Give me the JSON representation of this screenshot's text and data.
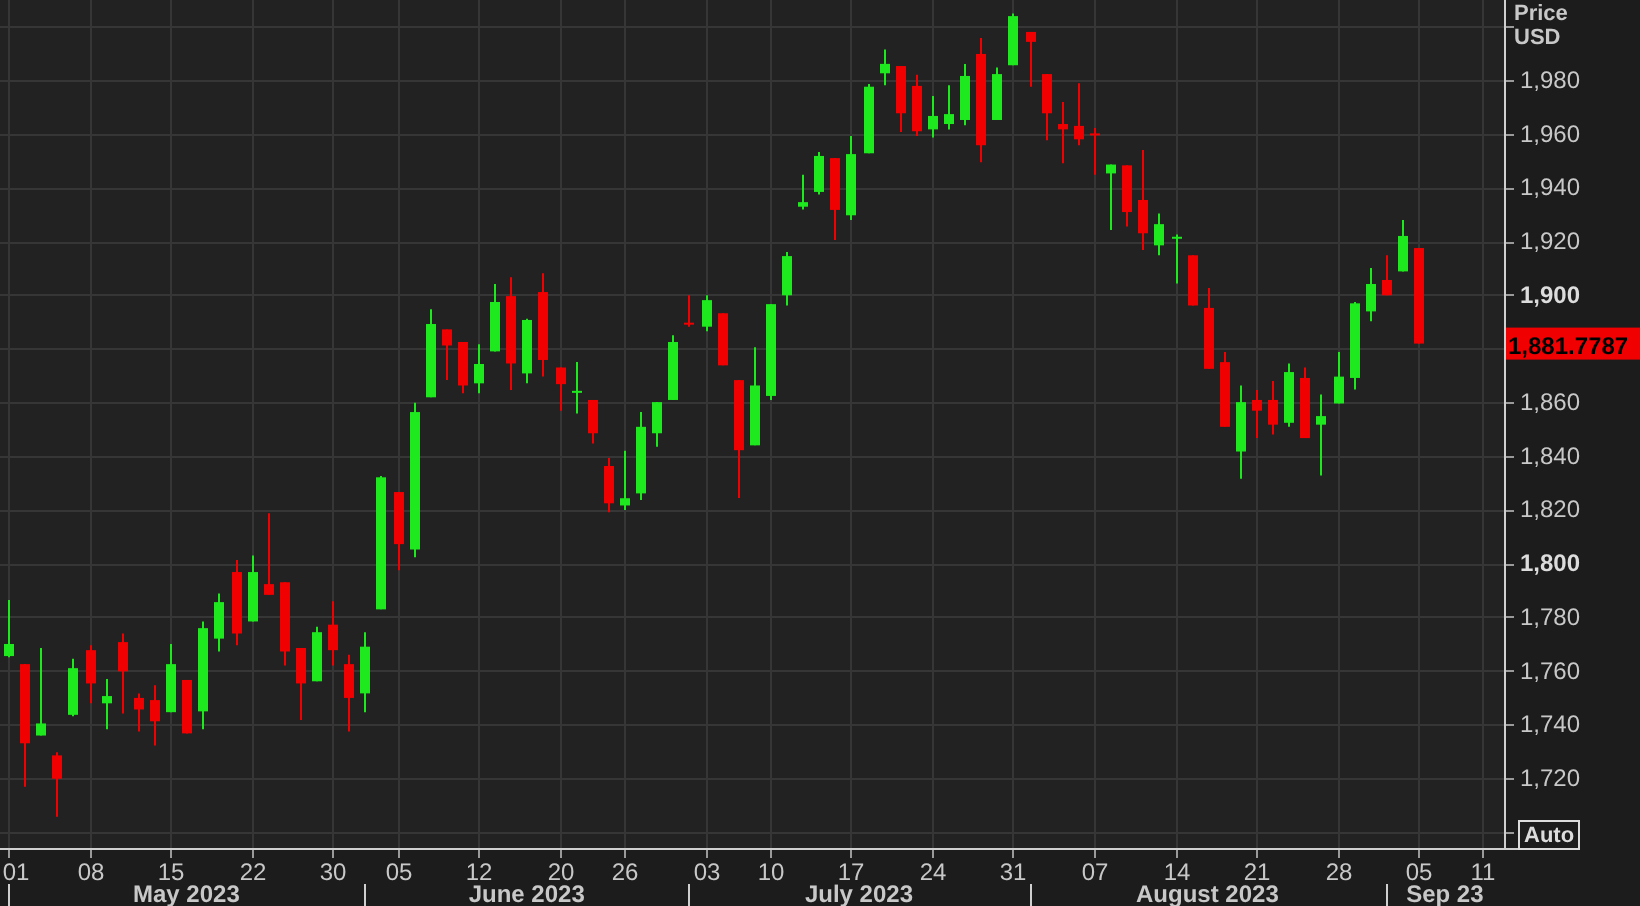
{
  "chart": {
    "price_header": {
      "title": "Price",
      "unit": "USD"
    },
    "chart_data": {
      "type": "candlestick",
      "grid": true,
      "ylim": [
        1693.9,
        2009.8
      ],
      "categories": [
        "01",
        null,
        null,
        null,
        null,
        "08",
        null,
        null,
        null,
        null,
        "15",
        null,
        null,
        null,
        null,
        "22",
        null,
        null,
        null,
        null,
        "30",
        null,
        null,
        null,
        "05",
        null,
        null,
        null,
        null,
        "12",
        null,
        null,
        null,
        null,
        "20",
        null,
        null,
        null,
        "26",
        null,
        null,
        null,
        null,
        "03",
        null,
        null,
        null,
        "10",
        null,
        null,
        null,
        null,
        "17",
        null,
        null,
        null,
        null,
        "24",
        null,
        null,
        null,
        null,
        "31",
        null,
        null,
        null,
        null,
        "07",
        null,
        null,
        null,
        null,
        "14",
        null,
        null,
        null,
        null,
        "21",
        null,
        null,
        null,
        null,
        "28",
        null,
        null,
        null,
        null,
        "05",
        null,
        null,
        null,
        "11"
      ],
      "ohlc": [
        [
          1765.4,
          1786.3,
          1765.0,
          1769.9
        ],
        [
          1762.4,
          1762.4,
          1716.7,
          1732.9
        ],
        [
          1735.8,
          1768.4,
          1735.8,
          1740.3
        ],
        [
          1728.4,
          1729.6,
          1705.5,
          1719.7
        ],
        [
          1743.5,
          1764.4,
          1743.0,
          1760.9
        ],
        [
          1767.6,
          1769.4,
          1747.8,
          1755.2
        ],
        [
          1747.8,
          1756.9,
          1738.1,
          1750.5
        ],
        [
          1770.6,
          1773.8,
          1744.0,
          1759.7
        ],
        [
          1749.8,
          1751.5,
          1737.3,
          1745.5
        ],
        [
          1749.0,
          1754.5,
          1732.1,
          1741.1
        ],
        [
          1744.5,
          1769.9,
          1744.5,
          1762.4
        ],
        [
          1756.5,
          1756.5,
          1736.6,
          1736.6
        ],
        [
          1744.8,
          1778.3,
          1738.1,
          1775.8
        ],
        [
          1771.9,
          1788.7,
          1767.1,
          1785.5
        ],
        [
          1796.7,
          1801.2,
          1769.4,
          1773.8
        ],
        [
          1778.3,
          1802.9,
          1778.3,
          1796.7
        ],
        [
          1792.2,
          1818.6,
          1788.2,
          1788.2
        ],
        [
          1792.9,
          1792.9,
          1761.9,
          1767.1
        ],
        [
          1768.4,
          1768.4,
          1741.6,
          1755.2
        ],
        [
          1756.0,
          1776.3,
          1756.0,
          1774.3
        ],
        [
          1777.1,
          1785.8,
          1761.9,
          1767.6
        ],
        [
          1762.4,
          1765.9,
          1737.3,
          1749.8
        ],
        [
          1751.5,
          1774.3,
          1744.5,
          1768.9
        ],
        [
          1782.8,
          1832.5,
          1782.8,
          1832.0
        ],
        [
          1826.5,
          1826.5,
          1797.4,
          1807.1
        ],
        [
          1805.1,
          1859.8,
          1802.2,
          1856.3
        ],
        [
          1861.8,
          1894.6,
          1861.8,
          1889.1
        ],
        [
          1887.1,
          1887.1,
          1868.2,
          1881.1
        ],
        [
          1882.4,
          1882.4,
          1863.3,
          1866.2
        ],
        [
          1867.0,
          1881.6,
          1863.3,
          1874.2
        ],
        [
          1878.9,
          1904.0,
          1878.9,
          1897.3
        ],
        [
          1899.5,
          1906.5,
          1864.5,
          1874.4
        ],
        [
          1870.7,
          1891.1,
          1867.0,
          1890.6
        ],
        [
          1901.0,
          1908.0,
          1869.5,
          1875.7
        ],
        [
          1872.9,
          1872.9,
          1856.8,
          1866.7
        ],
        [
          1863.5,
          1874.9,
          1855.8,
          1864.2
        ],
        [
          1860.8,
          1860.8,
          1844.6,
          1848.4
        ],
        [
          1836.2,
          1839.2,
          1819.0,
          1822.3
        ],
        [
          1821.5,
          1841.9,
          1819.8,
          1824.2
        ],
        [
          1826.0,
          1856.3,
          1823.5,
          1850.8
        ],
        [
          1848.4,
          1860.0,
          1843.4,
          1860.0
        ],
        [
          1860.8,
          1884.9,
          1860.8,
          1882.4
        ],
        [
          1889.6,
          1899.8,
          1888.1,
          1889.1
        ],
        [
          1888.1,
          1899.8,
          1886.4,
          1898.0
        ],
        [
          1893.1,
          1893.1,
          1873.7,
          1873.7
        ],
        [
          1868.2,
          1868.2,
          1824.3,
          1842.1
        ],
        [
          1843.9,
          1880.4,
          1843.9,
          1866.2
        ],
        [
          1862.3,
          1896.5,
          1860.8,
          1896.5
        ],
        [
          1899.8,
          1915.9,
          1896.0,
          1914.4
        ],
        [
          1932.8,
          1944.7,
          1931.8,
          1934.5
        ],
        [
          1938.3,
          1953.2,
          1937.3,
          1951.7
        ],
        [
          1950.9,
          1950.9,
          1920.4,
          1931.6
        ],
        [
          1929.6,
          1959.1,
          1927.8,
          1952.4
        ],
        [
          1952.7,
          1978.5,
          1952.7,
          1977.5
        ],
        [
          1982.5,
          1991.4,
          1978.0,
          1986.0
        ],
        [
          1985.2,
          1985.2,
          1960.6,
          1967.6
        ],
        [
          1977.8,
          1982.0,
          1959.1,
          1960.9
        ],
        [
          1961.6,
          1974.0,
          1958.6,
          1966.6
        ],
        [
          1963.6,
          1978.0,
          1961.6,
          1967.3
        ],
        [
          1965.1,
          1986.0,
          1963.1,
          1981.5
        ],
        [
          1989.7,
          1995.6,
          1949.4,
          1955.7
        ],
        [
          1965.1,
          1984.7,
          1965.1,
          1982.2
        ],
        [
          1985.5,
          2004.8,
          1985.5,
          2003.8
        ],
        [
          1997.9,
          1997.9,
          1977.5,
          1994.2
        ],
        [
          1982.2,
          1982.2,
          1957.6,
          1967.6
        ],
        [
          1963.6,
          1971.8,
          1949.0,
          1961.6
        ],
        [
          1962.9,
          1978.8,
          1955.7,
          1957.9
        ],
        [
          1960.1,
          1962.1,
          1944.7,
          1959.4
        ],
        [
          1945.2,
          1948.5,
          1924.1,
          1948.5
        ],
        [
          1948.2,
          1948.2,
          1925.4,
          1930.8
        ],
        [
          1935.3,
          1953.9,
          1916.7,
          1922.9
        ],
        [
          1918.4,
          1930.3,
          1914.7,
          1926.3
        ],
        [
          1920.9,
          1922.4,
          1904.2,
          1921.6
        ],
        [
          1914.7,
          1914.7,
          1896.0,
          1896.0
        ],
        [
          1895.1,
          1902.5,
          1872.4,
          1872.4
        ],
        [
          1874.9,
          1878.7,
          1850.8,
          1850.8
        ],
        [
          1841.6,
          1866.2,
          1831.5,
          1860.0
        ],
        [
          1860.8,
          1864.5,
          1846.6,
          1856.8
        ],
        [
          1860.8,
          1867.9,
          1847.9,
          1851.6
        ],
        [
          1852.3,
          1874.4,
          1850.8,
          1871.2
        ],
        [
          1869.0,
          1872.9,
          1846.6,
          1846.6
        ],
        [
          1851.6,
          1862.8,
          1832.7,
          1854.8
        ],
        [
          1859.5,
          1878.7,
          1859.5,
          1869.5
        ],
        [
          1869.0,
          1897.3,
          1864.7,
          1896.8
        ],
        [
          1893.8,
          1910.0,
          1890.1,
          1904.0
        ],
        [
          1905.5,
          1914.7,
          1899.8,
          1899.8
        ],
        [
          1908.7,
          1927.8,
          1908.7,
          1921.9
        ],
        [
          1917.4,
          1917.4,
          1881.8,
          1881.8
        ],
        null,
        null,
        null,
        null
      ],
      "yticks": [
        {
          "value": 1720,
          "label": "1,720"
        },
        {
          "value": 1740,
          "label": "1,740"
        },
        {
          "value": 1760,
          "label": "1,760"
        },
        {
          "value": 1780,
          "label": "1,780"
        },
        {
          "value": 1800,
          "label": "1,800"
        },
        {
          "value": 1820,
          "label": "1,820"
        },
        {
          "value": 1840,
          "label": "1,840"
        },
        {
          "value": 1860,
          "label": "1,860"
        },
        {
          "value": 1900,
          "label": "1,900"
        },
        {
          "value": 1920,
          "label": "1,920"
        },
        {
          "value": 1940,
          "label": "1,940"
        },
        {
          "value": 1960,
          "label": "1,960"
        },
        {
          "value": 1980,
          "label": "1,980"
        }
      ],
      "annotations": [
        "1,881.7787"
      ]
    },
    "month_axis": [
      "May 2023",
      "June 2023",
      "July 2023",
      "August 2023",
      "Sep 23"
    ],
    "auto_button": {
      "label": "Auto"
    }
  }
}
